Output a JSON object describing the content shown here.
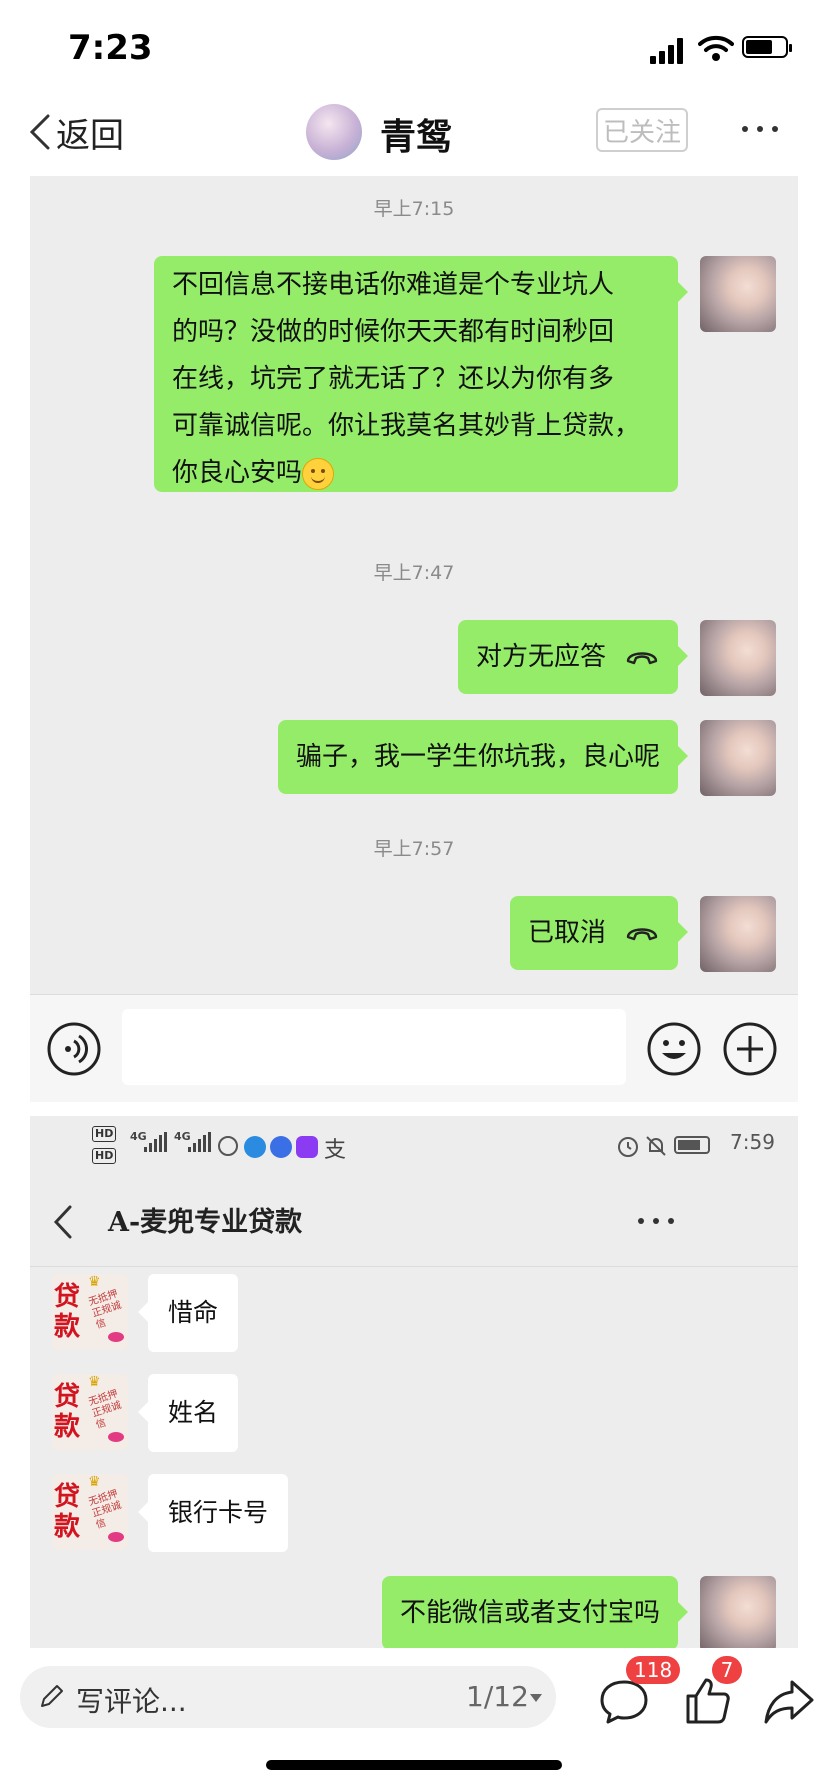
{
  "status_bar": {
    "time": "7:23"
  },
  "header": {
    "back_label": "返回",
    "title": "青鸳",
    "follow_label": "已关注"
  },
  "screenshot1": {
    "messages": [
      {
        "timestamp": "早上7:15"
      },
      {
        "lines": [
          "不回信息不接电话你难道是个专业坑人",
          "的吗？没做的时候你天天都有时间秒回",
          "在线，坑完了就无话了？还以为你有多",
          "可靠诚信呢。你让我莫名其妙背上贷款，",
          "你良心安吗"
        ]
      },
      {
        "timestamp": "早上7:47"
      },
      {
        "text": "对方无应答",
        "icon": "phone-hangup-icon"
      },
      {
        "text": "骗子，我一学生你坑我，良心呢"
      },
      {
        "timestamp": "早上7:57"
      },
      {
        "text": "已取消",
        "icon": "phone-hangup-icon"
      }
    ]
  },
  "screenshot2": {
    "status_time": "7:59",
    "network_labels": [
      "HD",
      "HD",
      "4G",
      "4G"
    ],
    "title": "A-麦兜专业贷款",
    "avatar_text": {
      "big": "贷款",
      "small": "无抵押正规诚信"
    },
    "messages": [
      {
        "from": "them",
        "text": "惜命"
      },
      {
        "from": "them",
        "text": "姓名"
      },
      {
        "from": "them",
        "text": "银行卡号"
      },
      {
        "from": "me",
        "text": "不能微信或者支付宝吗"
      }
    ]
  },
  "bottom_bar": {
    "comment_placeholder": "写评论...",
    "page_indicator": "1/12",
    "comment_count": "118",
    "like_count": "7"
  }
}
